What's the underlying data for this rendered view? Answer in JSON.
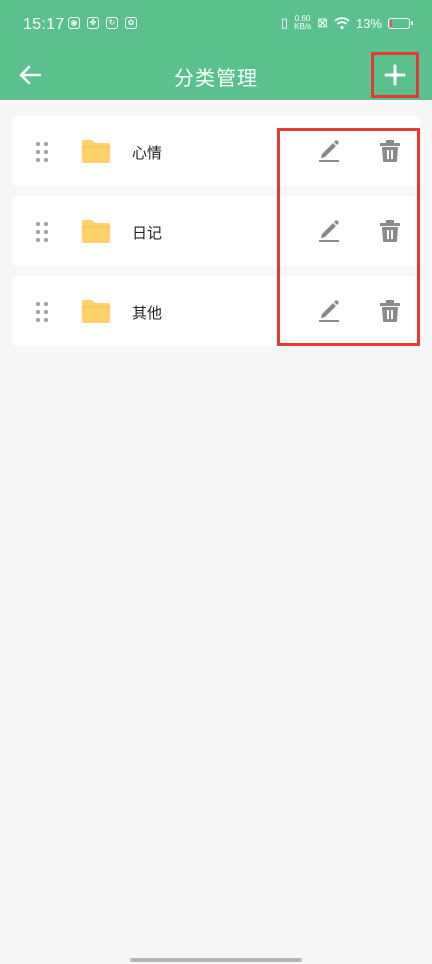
{
  "status_bar": {
    "time": "15:17",
    "net_speed_value": "0.60",
    "net_speed_unit": "KB/s",
    "battery_percent_label": "13%",
    "battery_level": 0.13
  },
  "app_bar": {
    "title": "分类管理",
    "back_icon": "arrow-left-icon",
    "add_icon": "plus-icon"
  },
  "categories": [
    {
      "label": "心情"
    },
    {
      "label": "日记"
    },
    {
      "label": "其他"
    }
  ],
  "row_icons": {
    "drag": "drag-handle-icon",
    "folder": "folder-icon",
    "edit": "pencil-icon",
    "delete": "trash-icon"
  },
  "colors": {
    "primary": "#5ac18e",
    "folder": "#ffd26a",
    "action_icon": "#8a8a8a",
    "highlight": "#e53935"
  }
}
